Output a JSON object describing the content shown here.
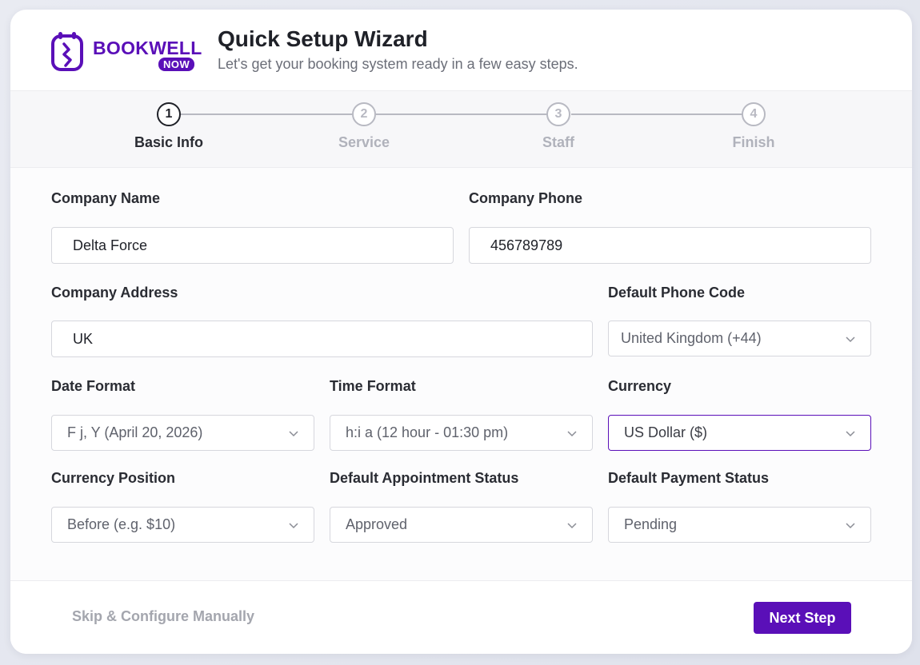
{
  "brand": {
    "name": "BOOKWELL",
    "badge": "NOW",
    "color": "#5a0fb8"
  },
  "header": {
    "title": "Quick Setup Wizard",
    "subtitle": "Let's get your booking system ready in a few easy steps."
  },
  "steps": [
    {
      "number": "1",
      "label": "Basic Info",
      "active": true
    },
    {
      "number": "2",
      "label": "Service",
      "active": false
    },
    {
      "number": "3",
      "label": "Staff",
      "active": false
    },
    {
      "number": "4",
      "label": "Finish",
      "active": false
    }
  ],
  "form": {
    "company_name": {
      "label": "Company Name",
      "value": "Delta Force"
    },
    "company_phone": {
      "label": "Company Phone",
      "value": "456789789"
    },
    "company_address": {
      "label": "Company Address",
      "value": "UK"
    },
    "default_phone_code": {
      "label": "Default Phone Code",
      "value": "United Kingdom (+44)"
    },
    "date_format": {
      "label": "Date Format",
      "value": "F j, Y (April 20, 2026)"
    },
    "time_format": {
      "label": "Time Format",
      "value": "h:i a (12 hour - 01:30 pm)"
    },
    "currency": {
      "label": "Currency",
      "value": "US Dollar ($)"
    },
    "currency_position": {
      "label": "Currency Position",
      "value": "Before (e.g. $10)"
    },
    "default_appointment_status": {
      "label": "Default Appointment Status",
      "value": "Approved"
    },
    "default_payment_status": {
      "label": "Default Payment Status",
      "value": "Pending"
    }
  },
  "footer": {
    "skip_label": "Skip & Configure Manually",
    "next_label": "Next Step"
  },
  "icons": {
    "select_arrow": "chevron-down-icon",
    "logo": "bookwell-logo-icon"
  }
}
